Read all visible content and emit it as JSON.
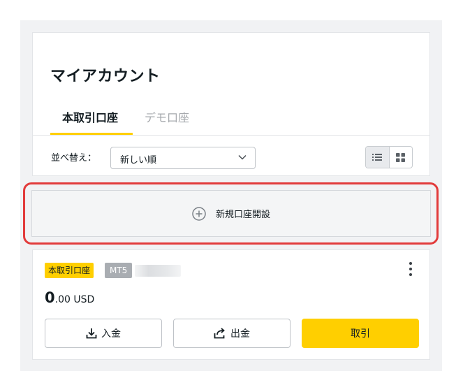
{
  "account": {
    "title": "マイアカウント",
    "tabs": [
      {
        "label": "本取引口座",
        "active": true
      },
      {
        "label": "デモ口座",
        "active": false
      }
    ]
  },
  "sort": {
    "label": "並べ替え：",
    "selected": "新しい順"
  },
  "view_toggle": {
    "options": [
      "list-icon",
      "grid-icon"
    ],
    "active": "list-icon"
  },
  "new_account": {
    "label": "新規口座開設"
  },
  "account_card": {
    "type_badge": "本取引口座",
    "platform_badge": "MT5",
    "balance_integer": "0",
    "balance_rest": ".00 USD",
    "deposit_label": "入金",
    "withdraw_label": "出金",
    "trade_label": "取引"
  },
  "colors": {
    "accent": "#ffcf00",
    "highlight": "#e23b3b"
  }
}
